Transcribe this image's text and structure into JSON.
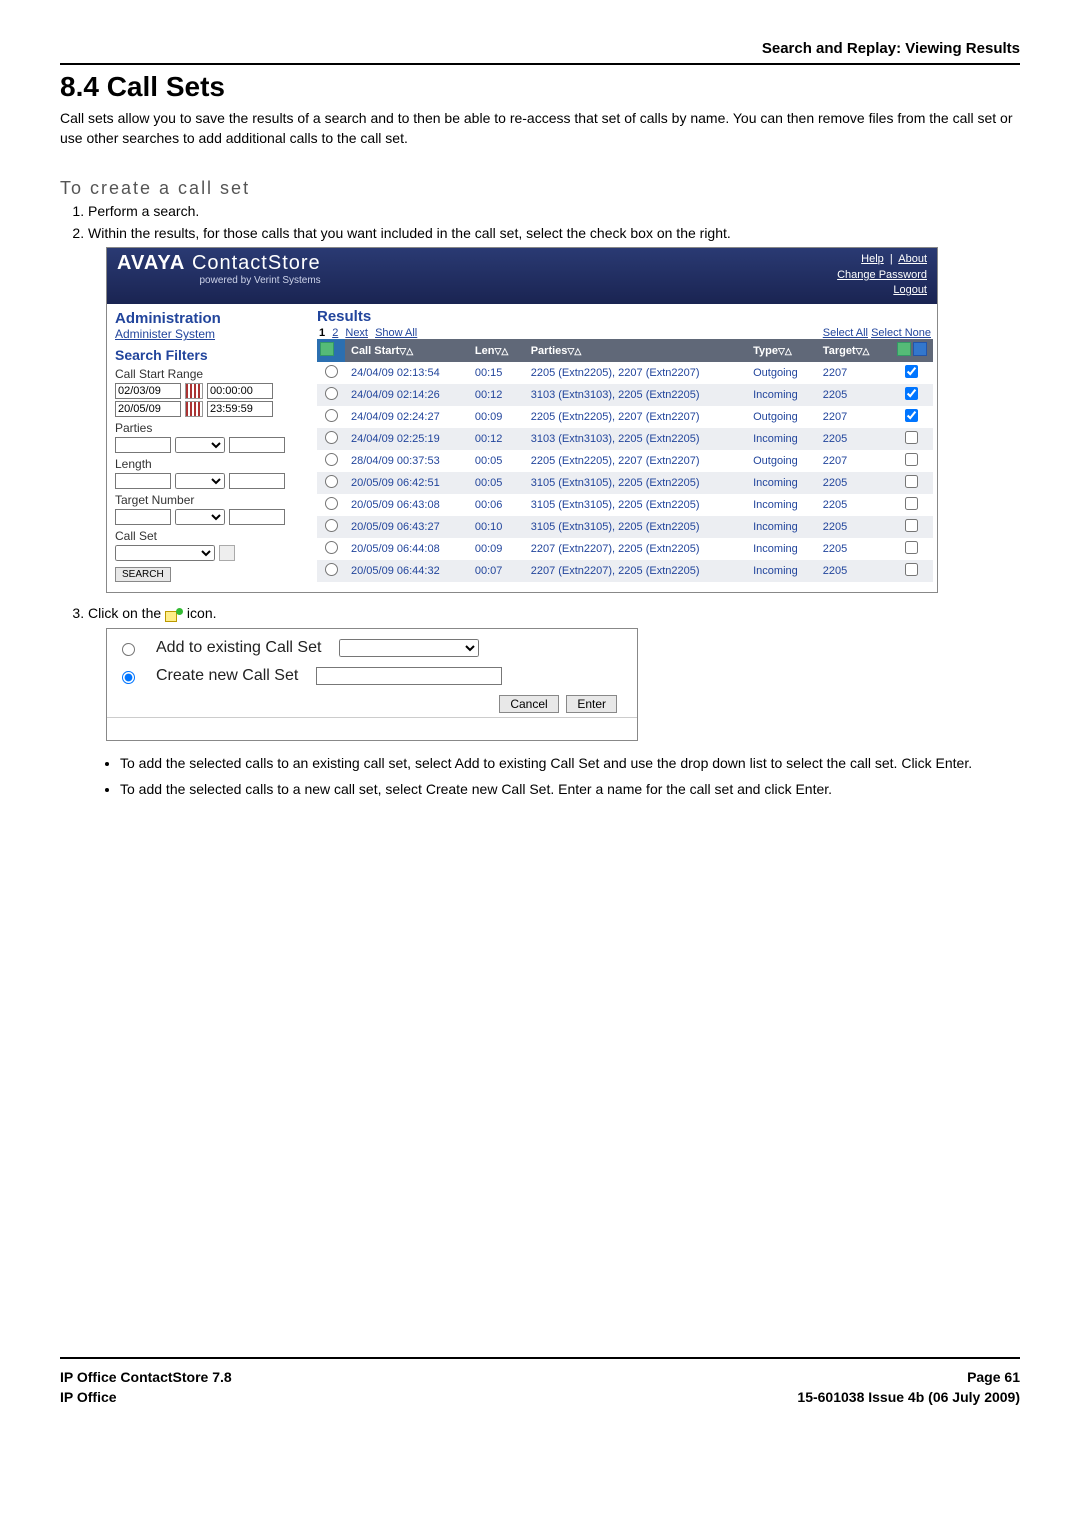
{
  "header_right": "Search and Replay: Viewing Results",
  "title": "8.4 Call Sets",
  "intro": "Call sets allow you to save the results of a search and to then be able to re-access that set of calls by name. You can then remove files from the call set or use other searches to add additional calls to the call set.",
  "subhead": "To create a call set",
  "step1": "Perform a search.",
  "step2": "Within the results, for those calls that you want included in the call set, select the check box on the right.",
  "step3_a": "Click on the ",
  "step3_b": " icon.",
  "bullet1": "To add the selected calls to an existing call set, select Add to existing Call Set and use the drop down list to select the call set. Click Enter.",
  "bullet2": "To add the selected calls to a new call set, select Create new Call Set. Enter a name for the call set and click Enter.",
  "app": {
    "brand1": "AVAYA",
    "brand2": "ContactStore",
    "brand_sub": "powered by Verint Systems",
    "links": {
      "help": "Help",
      "about": "About",
      "changepw": "Change Password",
      "logout": "Logout"
    },
    "admin_title": "Administration",
    "admin_link": "Administer System",
    "sf_title": "Search Filters",
    "csr_label": "Call Start Range",
    "date1": "02/03/09",
    "time1": "00:00:00",
    "date2": "20/05/09",
    "time2": "23:59:59",
    "parties_label": "Parties",
    "length_label": "Length",
    "target_label": "Target Number",
    "callset_label": "Call Set",
    "search_btn": "SEARCH",
    "results_title": "Results",
    "pager": {
      "p1": "1",
      "p2": "2",
      "next": "Next",
      "showall": "Show All",
      "selall": "Select All",
      "selnone": "Select None"
    },
    "cols": {
      "callstart": "Call Start",
      "len": "Len",
      "parties": "Parties",
      "type": "Type",
      "target": "Target"
    },
    "rows": [
      {
        "start": "24/04/09 02:13:54",
        "len": "00:15",
        "parties": "2205 (Extn2205), 2207 (Extn2207)",
        "type": "Outgoing",
        "target": "2207",
        "chk": true
      },
      {
        "start": "24/04/09 02:14:26",
        "len": "00:12",
        "parties": "3103 (Extn3103), 2205 (Extn2205)",
        "type": "Incoming",
        "target": "2205",
        "chk": true
      },
      {
        "start": "24/04/09 02:24:27",
        "len": "00:09",
        "parties": "2205 (Extn2205), 2207 (Extn2207)",
        "type": "Outgoing",
        "target": "2207",
        "chk": true
      },
      {
        "start": "24/04/09 02:25:19",
        "len": "00:12",
        "parties": "3103 (Extn3103), 2205 (Extn2205)",
        "type": "Incoming",
        "target": "2205",
        "chk": false
      },
      {
        "start": "28/04/09 00:37:53",
        "len": "00:05",
        "parties": "2205 (Extn2205), 2207 (Extn2207)",
        "type": "Outgoing",
        "target": "2207",
        "chk": false
      },
      {
        "start": "20/05/09 06:42:51",
        "len": "00:05",
        "parties": "3105 (Extn3105), 2205 (Extn2205)",
        "type": "Incoming",
        "target": "2205",
        "chk": false
      },
      {
        "start": "20/05/09 06:43:08",
        "len": "00:06",
        "parties": "3105 (Extn3105), 2205 (Extn2205)",
        "type": "Incoming",
        "target": "2205",
        "chk": false
      },
      {
        "start": "20/05/09 06:43:27",
        "len": "00:10",
        "parties": "3105 (Extn3105), 2205 (Extn2205)",
        "type": "Incoming",
        "target": "2205",
        "chk": false
      },
      {
        "start": "20/05/09 06:44:08",
        "len": "00:09",
        "parties": "2207 (Extn2207), 2205 (Extn2205)",
        "type": "Incoming",
        "target": "2205",
        "chk": false
      },
      {
        "start": "20/05/09 06:44:32",
        "len": "00:07",
        "parties": "2207 (Extn2207), 2205 (Extn2205)",
        "type": "Incoming",
        "target": "2205",
        "chk": false
      }
    ]
  },
  "dialog": {
    "opt1": "Add to existing Call Set",
    "opt2": "Create new Call Set",
    "cancel": "Cancel",
    "enter": "Enter"
  },
  "footer": {
    "left1": "IP Office ContactStore 7.8",
    "left2": "IP Office",
    "right1": "Page 61",
    "right2": "15-601038 Issue 4b (06 July 2009)"
  }
}
